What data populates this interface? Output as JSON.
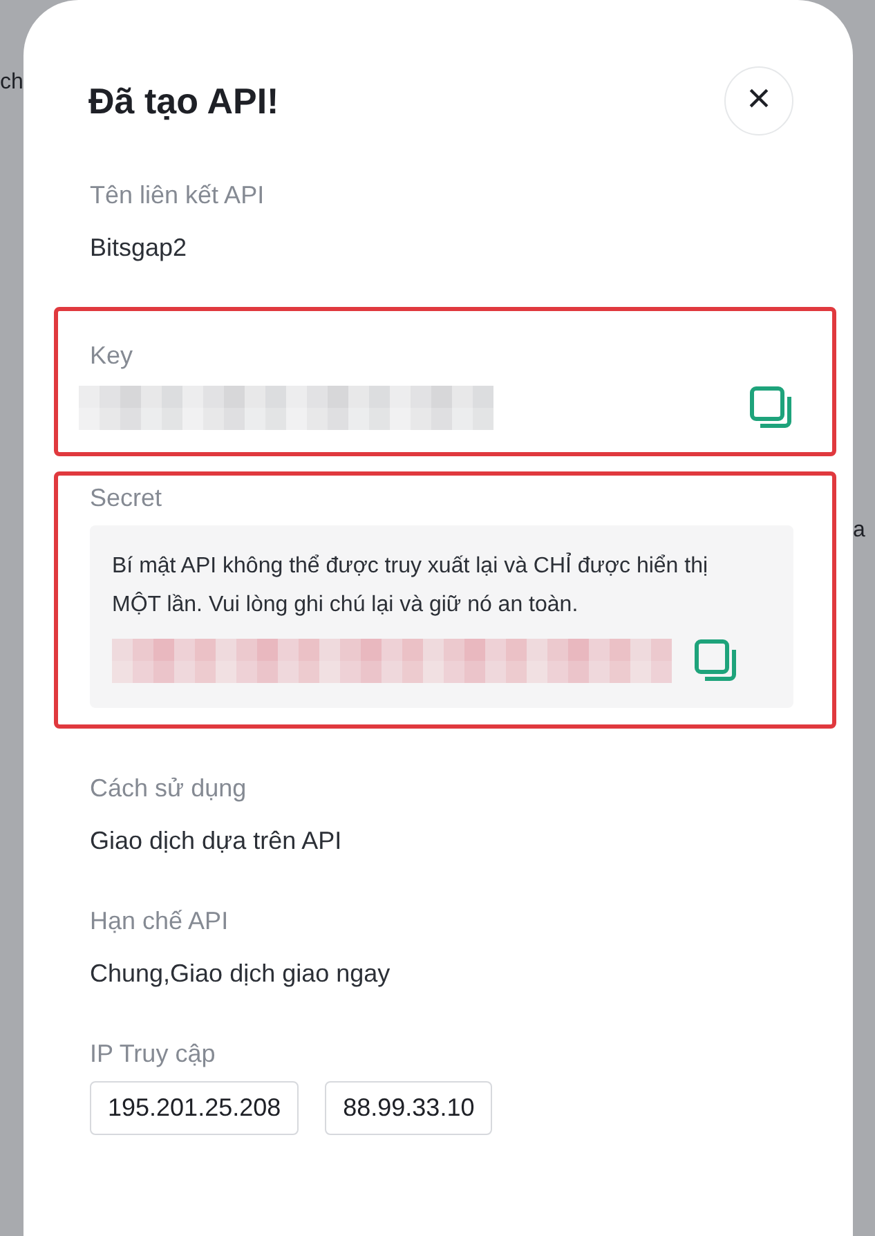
{
  "background": {
    "left_fragment": "ch",
    "right_fragment": "a"
  },
  "dialog": {
    "title": "Đã tạo API!",
    "close_label": "×",
    "fields": [
      {
        "kind": "text",
        "label": "Tên liên kết API",
        "value": "Bitsgap2",
        "highlighted": false
      },
      {
        "kind": "masked",
        "label": "Key",
        "highlighted": true
      },
      {
        "kind": "secret",
        "label": "Secret",
        "notice": "Bí mật API không thể được truy xuất lại và CHỈ được hiển thị MỘT lần. Vui lòng ghi chú lại và giữ nó an toàn.",
        "highlighted": true
      },
      {
        "kind": "text",
        "label": "Cách sử dụng",
        "value": "Giao dịch dựa trên API",
        "highlighted": false
      },
      {
        "kind": "text",
        "label": "Hạn chế API",
        "value": "Chung,Giao dịch giao ngay",
        "highlighted": false
      },
      {
        "kind": "chips",
        "label": "IP Truy cập",
        "chips": [
          "195.201.25.208",
          "88.99.33.10"
        ],
        "highlighted": false
      }
    ]
  }
}
